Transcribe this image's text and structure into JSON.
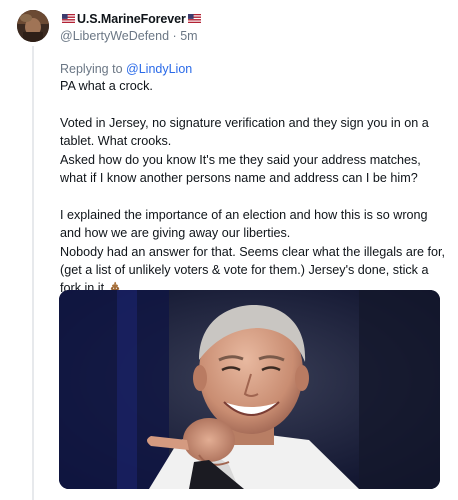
{
  "post": {
    "author": {
      "display_name": "U.S.MarineForever",
      "flag_icon": "us-flag-icon",
      "handle": "@LibertyWeDefend",
      "separator": "·",
      "time": "5m"
    },
    "reply": {
      "prefix": "Replying to",
      "mention": "@LindyLion"
    },
    "paragraphs": [
      [
        "PA what a crock."
      ],
      [
        "Voted in Jersey, no signature verification and they sign you in on a tablet. What crooks.",
        "Asked how do you know It's me they said your address matches, what if I know another persons name and address can I be him?"
      ],
      [
        "I explained the importance of an election and how this is so wrong and how we are giving away our liberties.",
        "Nobody had an answer for that. Seems clear what the illegals are for, (get a list of unlikely voters & vote for them.) Jersey's done, stick a fork in it."
      ]
    ],
    "trailing_emoji": "pile-of-poo-icon",
    "media": {
      "type": "photo",
      "subject": "smiling man pointing at camera",
      "colors": {
        "background": "#0c1130",
        "accent_stripe": "#2a2a6e"
      }
    }
  },
  "colors": {
    "text_primary": "#0f1419",
    "text_secondary": "#6b7785",
    "link": "#2a6ae8",
    "thread_line": "#e7e9ec"
  }
}
